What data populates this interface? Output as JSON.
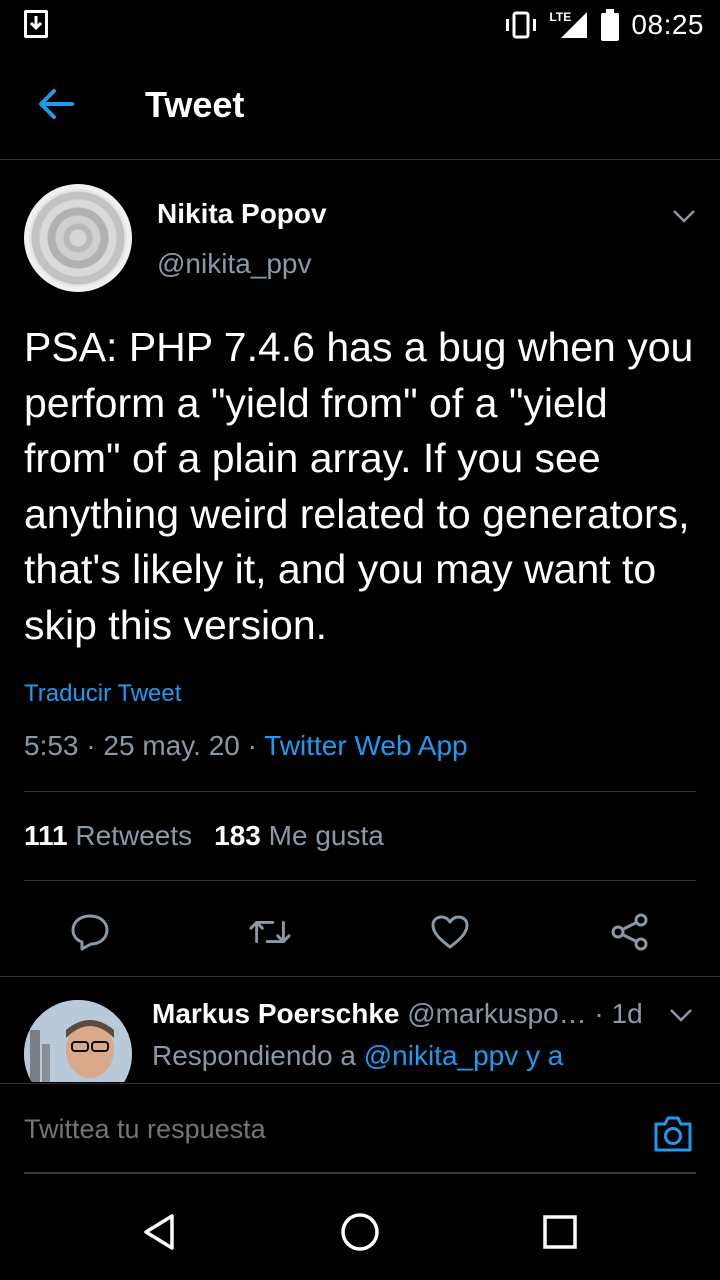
{
  "status_bar": {
    "time": "08:25",
    "network": "LTE"
  },
  "header": {
    "title": "Tweet"
  },
  "tweet": {
    "author_name": "Nikita Popov",
    "author_handle": "@nikita_ppv",
    "text": "PSA: PHP 7.4.6 has a bug when you perform a \"yield from\" of a \"yield from\" of a plain array. If you see anything weird related to generators, that's likely it, and you may want to skip this version.",
    "translate_label": "Traducir Tweet",
    "time": "5:53",
    "separator": " · ",
    "date": "25 may. 20",
    "source": "Twitter Web App",
    "retweets_count": "111",
    "retweets_label": "Retweets",
    "likes_count": "183",
    "likes_label": "Me gusta"
  },
  "reply": {
    "author_name": "Markus Poerschke",
    "author_handle": "@markuspo…",
    "age": "· 1d",
    "replying_prefix": "Respondiendo a",
    "replying_to": "@nikita_ppv y a"
  },
  "compose": {
    "placeholder": "Twittea tu respuesta"
  },
  "colors": {
    "accent": "#1d9bf0",
    "muted": "#8b98a5",
    "divider": "#2f3336"
  },
  "icons": [
    "download-icon",
    "vibrate-icon",
    "signal-icon",
    "battery-icon",
    "back-arrow-icon",
    "chevron-down-icon",
    "reply-icon",
    "retweet-icon",
    "like-icon",
    "share-icon",
    "camera-icon",
    "nav-back-icon",
    "nav-home-icon",
    "nav-recents-icon"
  ]
}
